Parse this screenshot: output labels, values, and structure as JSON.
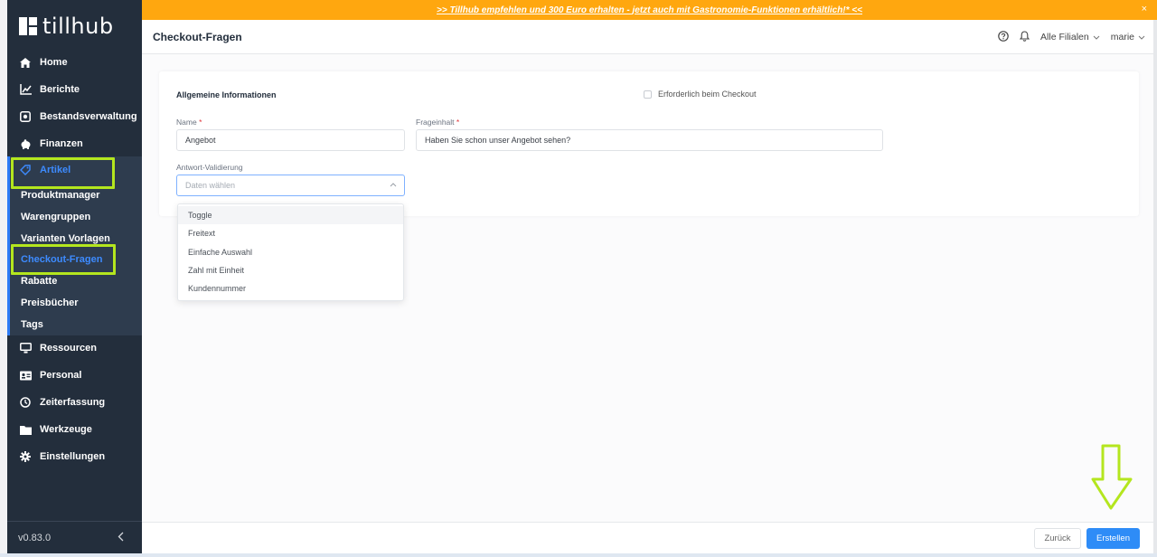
{
  "brand": {
    "name": "tillhub"
  },
  "banner": {
    "text": ">> Tillhub empfehlen und 300 Euro erhalten - jetzt auch mit Gastronomie-Funktionen erhältlich!* <<",
    "close": "×"
  },
  "header": {
    "title": "Checkout-Fragen",
    "branch": "Alle Filialen",
    "user": "marie"
  },
  "nav": {
    "home": "Home",
    "reports": "Berichte",
    "inventory": "Bestandsverwaltung",
    "finances": "Finanzen",
    "articles": "Artikel",
    "resources": "Ressourcen",
    "staff": "Personal",
    "timetracking": "Zeiterfassung",
    "tools": "Werkzeuge",
    "settings": "Einstellungen"
  },
  "subnav": [
    "Produktmanager",
    "Warengruppen",
    "Varianten Vorlagen",
    "Checkout-Fragen",
    "Rabatte",
    "Preisbücher",
    "Tags"
  ],
  "version": "v0.83.0",
  "form": {
    "section_title": "Allgemeine Informationen",
    "required_checkout_label": "Erforderlich beim Checkout",
    "name_label": "Name",
    "name_value": "Angebot",
    "question_label": "Frageinhalt",
    "question_value": "Haben Sie schon unser Angebot sehen?",
    "required_marker": "*",
    "validation_label": "Antwort-Validierung",
    "validation_placeholder": "Daten wählen"
  },
  "dropdown_options": [
    "Toggle",
    "Freitext",
    "Einfache Auswahl",
    "Zahl mit Einheit",
    "Kundennummer"
  ],
  "footer": {
    "back": "Zurück",
    "create": "Erstellen"
  },
  "colors": {
    "sidebar": "#232e3c",
    "accent": "#2e8cf7",
    "banner": "#ffa70f",
    "highlight": "#b4e61e"
  }
}
